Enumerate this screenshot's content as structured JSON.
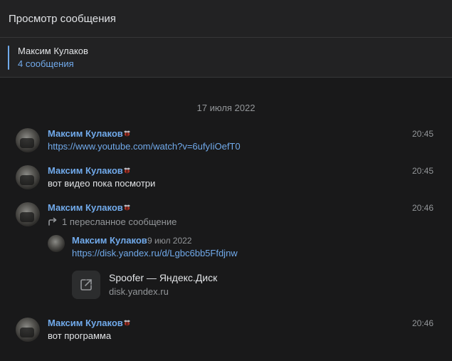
{
  "header": {
    "title": "Просмотр сообщения"
  },
  "sender": {
    "name": "Максим Кулаков",
    "count": "4 сообщения"
  },
  "date_separator": "17 июля 2022",
  "messages": [
    {
      "author": "Максим Кулаков",
      "time": "20:45",
      "text": "https://www.youtube.com/watch?v=6ufyIiOefT0"
    },
    {
      "author": "Максим Кулаков",
      "time": "20:45",
      "text": "вот видео пока посмотри"
    },
    {
      "author": "Максим Кулаков",
      "time": "20:46",
      "forwarded_label": "1 пересланное сообщение",
      "forwarded": {
        "author": "Максим Кулаков",
        "date": "9 июл 2022",
        "link": "https://disk.yandex.ru/d/Lgbc6bb5Ffdjnw",
        "card_title": "Spoofer — Яндекс.Диск",
        "card_domain": "disk.yandex.ru"
      }
    },
    {
      "author": "Максим Кулаков",
      "time": "20:46",
      "text": "вот программа"
    }
  ],
  "colors": {
    "accent": "#71aaeb",
    "background": "#19191a",
    "header_bg": "#222223"
  },
  "icons": {
    "author_badge": "bee-emoji-icon",
    "forward": "forward-arrow-icon",
    "card": "external-link-icon"
  }
}
